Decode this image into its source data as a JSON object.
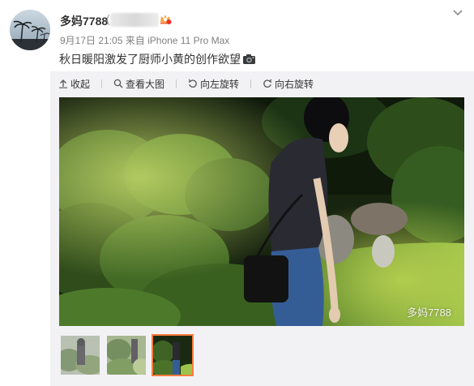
{
  "post": {
    "author": "多妈7788",
    "paren_open": "(",
    "meta_date": "9月17日 21:05",
    "meta_from": "来自",
    "meta_device": "iPhone 11 Pro Max",
    "text": "秋日暖阳激发了厨师小黄的创作欲望"
  },
  "toolbar": {
    "collapse": "收起",
    "view_large": "查看大图",
    "rotate_left": "向左旋转",
    "rotate_right": "向右旋转"
  },
  "photo": {
    "watermark": "多妈7788"
  },
  "thumbnails": {
    "count": 3,
    "active_index": 2
  },
  "colors": {
    "accent": "#fa7d3c",
    "media_bg": "#f2f2f5",
    "meta_text": "#808080"
  }
}
